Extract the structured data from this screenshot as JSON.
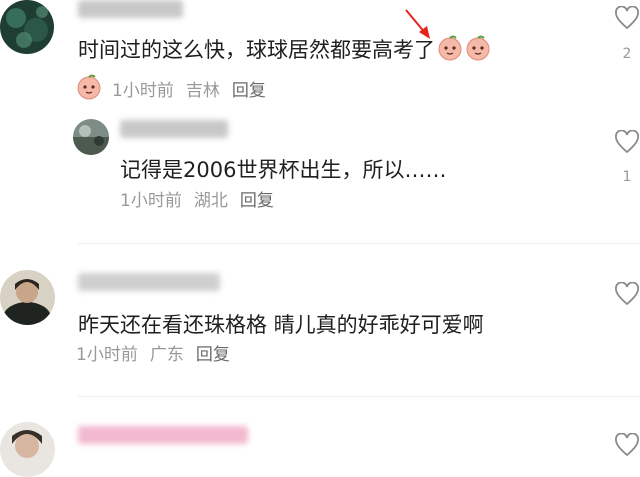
{
  "comments": [
    {
      "text": "时间过的这么快，球球居然都要高考了",
      "emoji_icon": "peach-face-emoji",
      "emoji_count": 3,
      "time": "1小时前",
      "location": "吉林",
      "reply_label": "回复",
      "likes": "2",
      "replies": [
        {
          "text": "记得是2006世界杯出生，所以……",
          "time": "1小时前",
          "location": "湖北",
          "reply_label": "回复",
          "likes": "1"
        }
      ]
    },
    {
      "text": "昨天还在看还珠格格 晴儿真的好乖好可爱啊",
      "time": "1小时前",
      "location": "广东",
      "reply_label": "回复"
    }
  ],
  "icons": {
    "like": "heart-outline-icon",
    "pointer": "red-arrow-annotation"
  },
  "colors": {
    "annotation_arrow": "#e5251a",
    "meta_text": "#999999"
  }
}
